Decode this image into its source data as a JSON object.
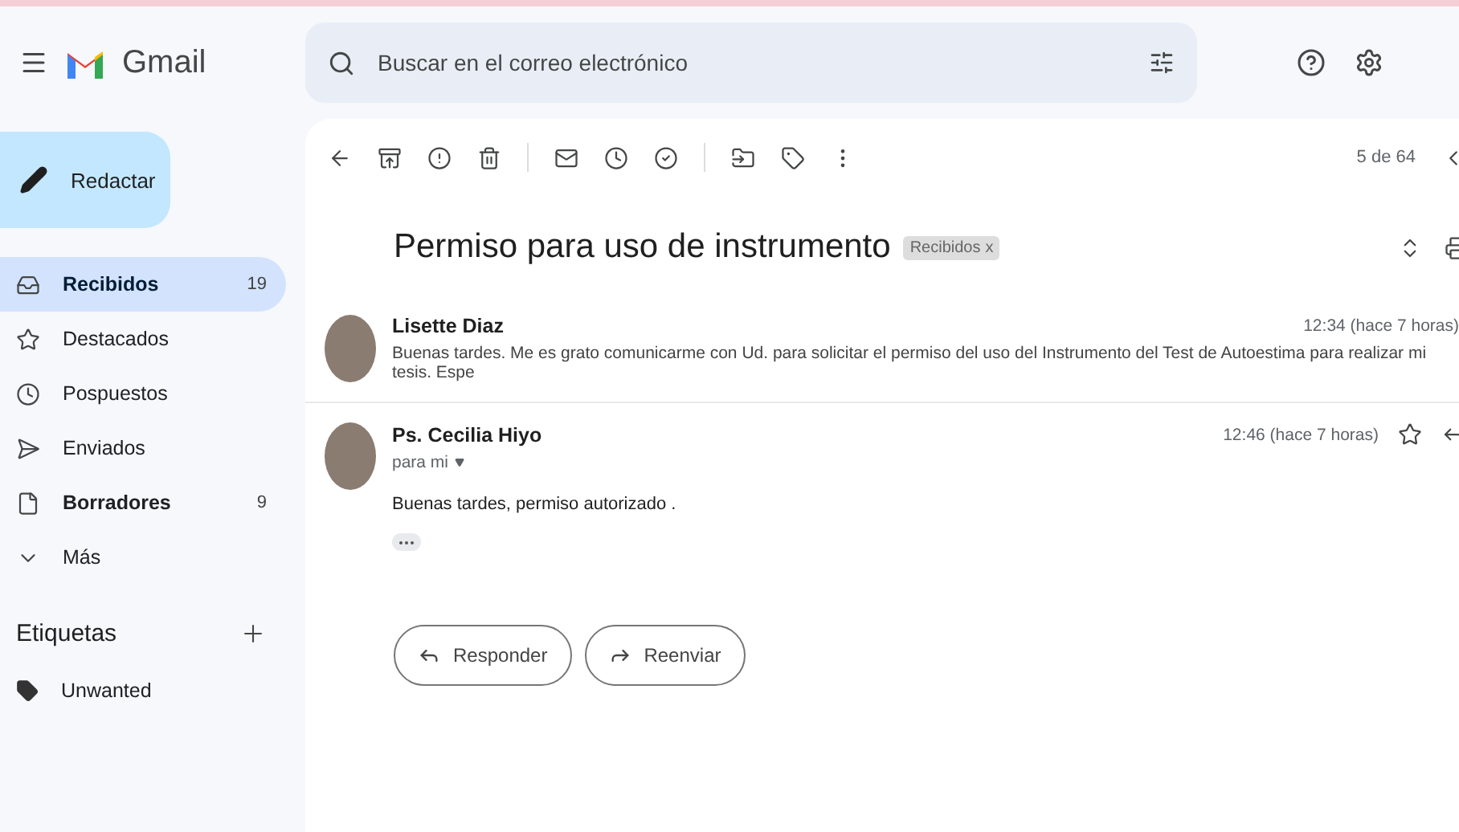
{
  "header": {
    "app_name": "Gmail",
    "search": {
      "placeholder": "Buscar en el correo electrónico"
    }
  },
  "sidebar": {
    "compose": "Redactar",
    "items": [
      {
        "label": "Recibidos",
        "count": "19",
        "selected": true,
        "bold": true,
        "kind": "inbox"
      },
      {
        "label": "Destacados",
        "selected": false,
        "bold": false,
        "kind": "starred"
      },
      {
        "label": "Pospuestos",
        "selected": false,
        "bold": false,
        "kind": "snoozed"
      },
      {
        "label": "Enviados",
        "selected": false,
        "bold": false,
        "kind": "sent"
      },
      {
        "label": "Borradores",
        "count": "9",
        "selected": false,
        "bold": true,
        "kind": "drafts"
      },
      {
        "label": "Más",
        "selected": false,
        "bold": false,
        "kind": "more"
      }
    ],
    "labels_heading": "Etiquetas",
    "labels": [
      {
        "label": "Unwanted",
        "selected": false
      }
    ]
  },
  "toolbar": {
    "pagination": "5 de 64"
  },
  "thread": {
    "subject": "Permiso para uso de instrumento",
    "label": {
      "text": "Recibidos",
      "close": "x"
    },
    "messages": [
      {
        "kind": "collapsed",
        "sender": "Lisette Diaz",
        "time": "12:34 (hace 7 horas)",
        "snippet": "Buenas tardes. Me es grato comunicarme con Ud. para solicitar el permiso del uso del Instrumento del Test de Autoestima para realizar mi tesis. Espe"
      },
      {
        "kind": "expanded",
        "sender": "Ps. Cecilia Hiyo",
        "time": "12:46 (hace 7 horas)",
        "recipient": "para mi",
        "body": "Buenas tardes, permiso autorizado .",
        "starred": false
      }
    ]
  },
  "actions": [
    "Responder",
    "Reenviar"
  ]
}
